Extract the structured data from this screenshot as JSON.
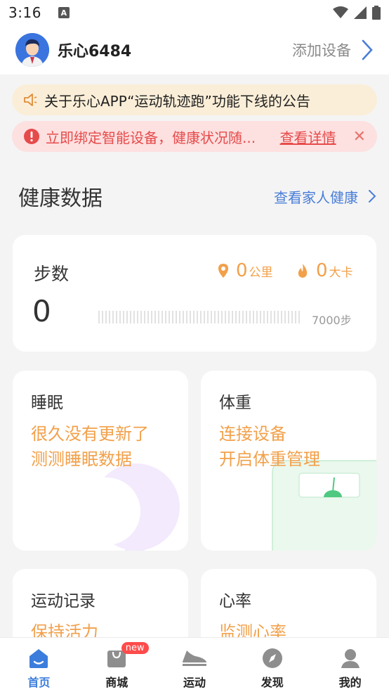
{
  "status_bar": {
    "time": "3:16",
    "a_icon": "A"
  },
  "header": {
    "username": "乐心6484",
    "add_device": "添加设备"
  },
  "notices": {
    "announcement": "关于乐心APP“运动轨迹跑”功能下线的公告",
    "warning": "立即绑定智能设备，健康状况随...",
    "warning_detail": "查看详情",
    "close_symbol": "✕"
  },
  "health": {
    "title": "健康数据",
    "family_link": "查看家人健康"
  },
  "steps": {
    "label": "步数",
    "count": "0",
    "distance_value": "0",
    "distance_unit": "公里",
    "calorie_value": "0",
    "calorie_unit": "大卡",
    "goal": "7000步",
    "progress_fraction": 0
  },
  "cards": {
    "sleep": {
      "title": "睡眠",
      "line1": "很久没有更新了",
      "line2": "测测睡眠数据"
    },
    "weight": {
      "title": "体重",
      "line1": "连接设备",
      "line2": "开启体重管理"
    },
    "sport": {
      "title": "运动记录",
      "line1": "保持活力"
    },
    "heart": {
      "title": "心率",
      "line1": "监测心率"
    }
  },
  "tabs": [
    {
      "label": "首页",
      "icon": "home-icon",
      "active": true
    },
    {
      "label": "商城",
      "icon": "shop-bag-icon",
      "badge": "new"
    },
    {
      "label": "运动",
      "icon": "shoe-icon"
    },
    {
      "label": "发现",
      "icon": "compass-icon"
    },
    {
      "label": "我的",
      "icon": "profile-icon"
    }
  ],
  "colors": {
    "accent_blue": "#3b7ddd",
    "orange": "#f2a04a",
    "warn_red": "#e64b4b",
    "announce_bg": "#fbeed8",
    "warn_bg": "#fde0e0"
  }
}
